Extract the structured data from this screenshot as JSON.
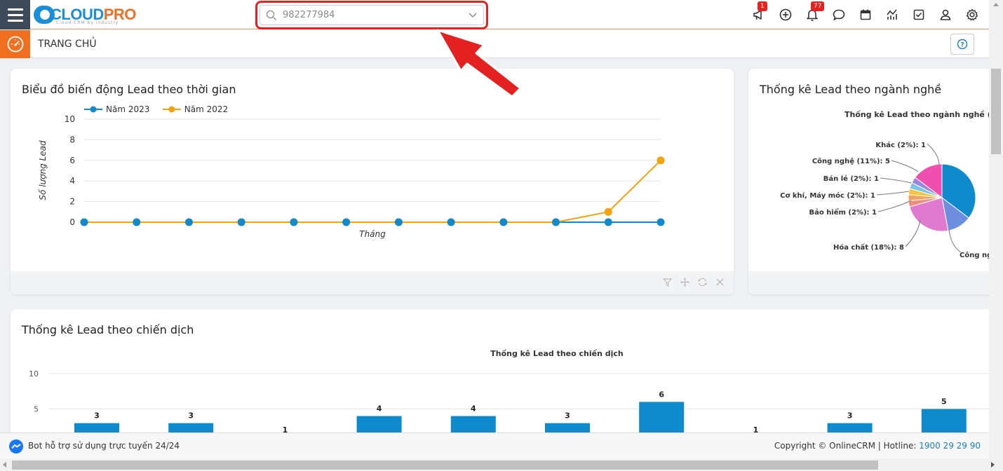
{
  "header": {
    "logo_text_a": "CLOUD",
    "logo_text_b": "PRO",
    "logo_tagline": "Cloud CRM by industry",
    "search_value": "982277984",
    "notification_badge": "1",
    "bell_badge": "77"
  },
  "subbar": {
    "title": "TRANG CHỦ",
    "help_label": "?"
  },
  "card_line": {
    "title": "Biểu đồ biến động Lead theo thời gian",
    "chart_data": {
      "type": "line",
      "title": "",
      "xlabel": "Tháng",
      "ylabel": "Số lượng Lead",
      "ylim": [
        0,
        10
      ],
      "yticks": [
        "0",
        "2",
        "4",
        "6",
        "8",
        "10"
      ],
      "x": [
        1,
        2,
        3,
        4,
        5,
        6,
        7,
        8,
        9,
        10,
        11,
        12
      ],
      "series": [
        {
          "name": "Năm 2023",
          "color": "#0e8acd",
          "values": [
            0,
            0,
            0,
            0,
            0,
            0,
            0,
            0,
            0,
            0,
            0,
            0
          ]
        },
        {
          "name": "Năm 2022",
          "color": "#f5a20d",
          "values": [
            0,
            0,
            0,
            0,
            0,
            0,
            0,
            0,
            0,
            0,
            1,
            6
          ]
        }
      ],
      "legend": "top-left",
      "grid": true
    }
  },
  "card_pie": {
    "title": "Thống kê Lead theo ngành nghề",
    "chart_data": {
      "type": "pie",
      "title": "Thống kê Lead theo ngành nghề (Σ",
      "labels": [
        "Khác (2%): 1",
        "Công nghệ (11%): 5",
        "Bán lẻ (2%): 1",
        "Cơ khí, Máy móc (2%): 1",
        "Bảo hiểm (2%): 1",
        "Hóa chất (18%): 8",
        "Công ng"
      ],
      "values": [
        1,
        5,
        1,
        1,
        1,
        8
      ],
      "legend": "none"
    }
  },
  "card_bar": {
    "title": "Thống kê Lead theo chiến dịch",
    "chart_data": {
      "type": "bar",
      "title": "Thống kê Lead theo chiến dịch",
      "ylim": [
        0,
        10
      ],
      "yticks": [
        "5",
        "10"
      ],
      "values": [
        3,
        3,
        1,
        4,
        4,
        3,
        6,
        1,
        3,
        5
      ],
      "color": "#0e8acd"
    }
  },
  "footer": {
    "bot_text": "Bot hỗ trợ sử dụng trực tuyến 24/24",
    "copyright": "Copyright © OnlineCRM",
    "hotline_label": "Hotline: ",
    "hotline_number": "1900 29 29 90"
  }
}
